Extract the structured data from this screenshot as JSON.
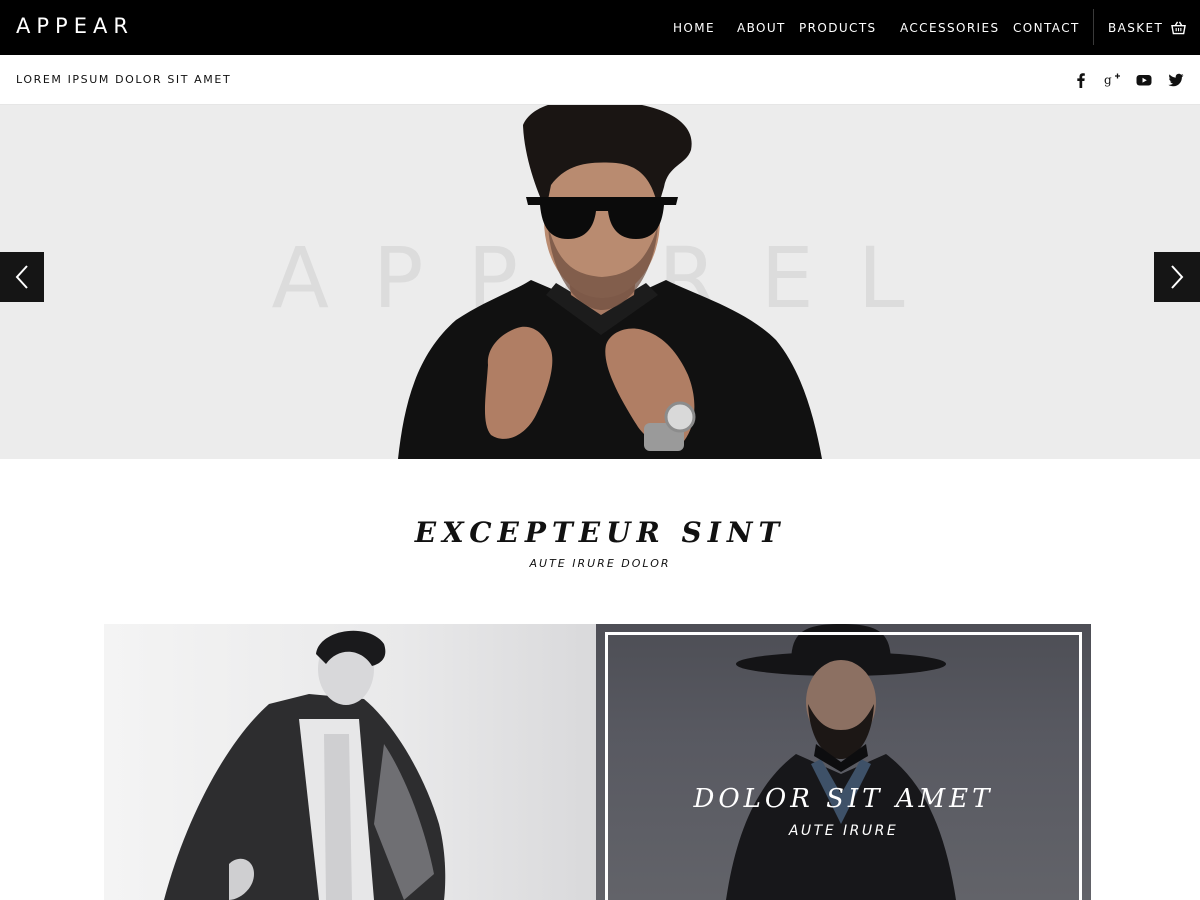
{
  "brand": {
    "logo_text": "APPEAR"
  },
  "nav": {
    "items": [
      {
        "label": "HOME"
      },
      {
        "label": "ABOUT"
      },
      {
        "label": "PRODUCTS"
      },
      {
        "label": "ACCESSORIES"
      },
      {
        "label": "CONTACT"
      }
    ],
    "basket_label": "BASKET",
    "basket_icon": "basket-icon"
  },
  "subbar": {
    "tagline": "LOREM IPSUM DOLOR SIT AMET",
    "social_icons": [
      "facebook-icon",
      "google-plus-icon",
      "youtube-icon",
      "twitter-icon"
    ]
  },
  "hero": {
    "background_word": "APPAREL",
    "prev_icon": "chevron-left-icon",
    "next_icon": "chevron-right-icon"
  },
  "section": {
    "title": "EXCEPTEUR SINT",
    "subtitle": "AUTE IRURE DOLOR"
  },
  "cards": {
    "right": {
      "title": "DOLOR SIT AMET",
      "subtitle": "AUTE IRURE"
    }
  },
  "colors": {
    "nav_bg": "#000000",
    "hero_bg": "#ececec",
    "arrow_bg": "#151515",
    "card_dark": "#55565d"
  }
}
